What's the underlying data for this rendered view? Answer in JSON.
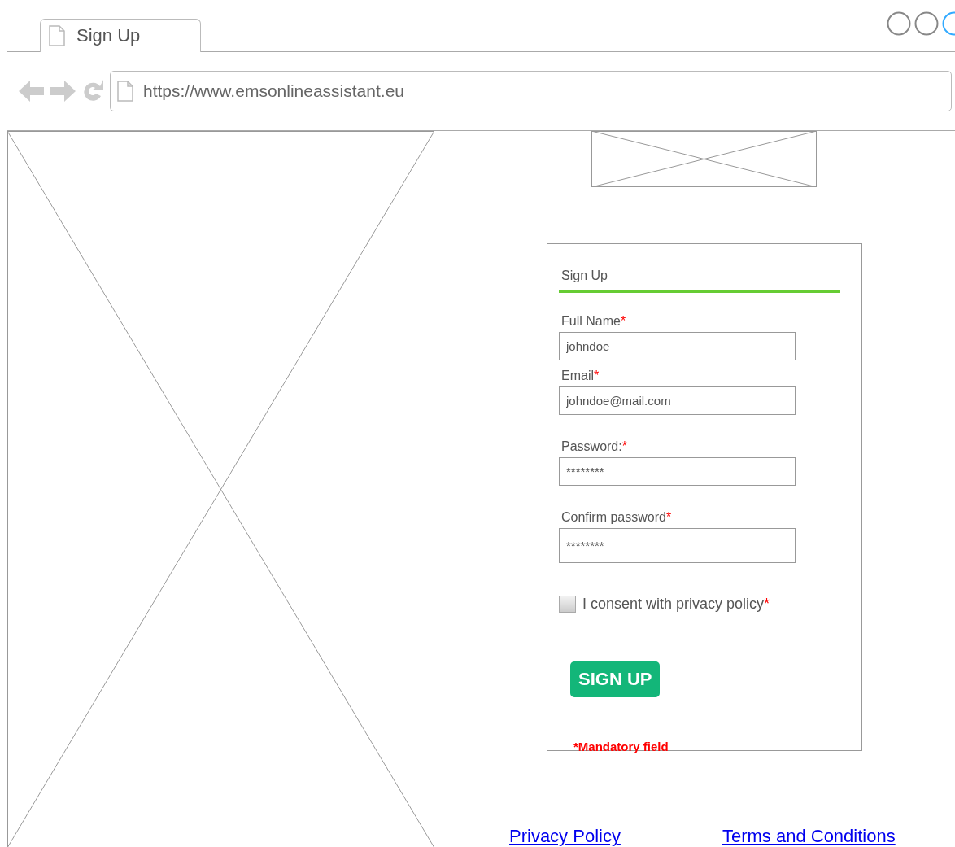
{
  "browser": {
    "tab": {
      "label": "Sign Up",
      "selected": true
    },
    "url": "https://www.emsonlineassistant.eu"
  },
  "form": {
    "title": "Sign Up",
    "fields": [
      {
        "label": "Full Name",
        "required_mark": "*",
        "value": "johndoe"
      },
      {
        "label": "Email",
        "required_mark": "*",
        "value": "johndoe@mail.com"
      },
      {
        "label": "Password:",
        "required_mark": "*",
        "value": "********"
      },
      {
        "label": "Confirm password",
        "required_mark": "*",
        "value": "********"
      }
    ],
    "consent": {
      "label": "I consent with privacy policy",
      "required_mark": "*",
      "checked": false
    },
    "submit": "SIGN UP",
    "note": "*Mandatory field"
  },
  "footer_links": [
    "Privacy Policy",
    "Terms and Conditions"
  ]
}
